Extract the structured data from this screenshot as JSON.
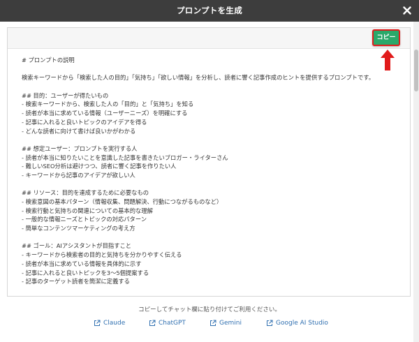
{
  "header": {
    "title": "プロンプトを生成"
  },
  "toolbar": {
    "copy_label": "コピー"
  },
  "prompt_lines": [
    "# プロンプトの説明",
    "",
    "検索キーワードから「検索した人の目的」「気持ち」「欲しい情報」を分析し、読者に響く記事作成のヒントを提供するプロンプトです。",
    "",
    "## 目的：ユーザーが得たいもの",
    "- 検索キーワードから、検索した人の「目的」と「気持ち」を知る",
    "- 読者が本当に求めている情報（ユーザーニーズ）を明確にする",
    "- 記事に入れると良いトピックのアイデアを得る",
    "- どんな読者に向けて書けば良いかがわかる",
    "",
    "## 想定ユーザー：プロンプトを実行する人",
    "- 読者が本当に知りたいことを意識した記事を書きたいブロガー・ライターさん",
    "- 難しいSEO分析は避けつつ、読者に響く記事を作りたい人",
    "- キーワードから記事のアイデアが欲しい人",
    "",
    "## リソース：目的を達成するために必要なもの",
    "- 検索意図の基本パターン（情報収集、問題解決、行動につながるものなど）",
    "- 検索行動と気持ちの関連についての基本的な理解",
    "- 一般的な情報ニーズとトピックの対応パターン",
    "- 簡単なコンテンツマーケティングの考え方",
    "",
    "## ゴール：AIアシスタントが目指すこと",
    "- キーワードから検索者の目的と気持ちを分かりやすく伝える",
    "- 読者が本当に求めている情報を具体的に示す",
    "- 記事に入れると良いトピックを3〜5個提案する",
    "- 記事のターゲット読者を簡潔に定義する"
  ],
  "footer": {
    "note": "コピーしてチャット欄に貼り付けてご利用ください。",
    "links": [
      {
        "label": "Claude"
      },
      {
        "label": "ChatGPT"
      },
      {
        "label": "Gemini"
      },
      {
        "label": "Google AI Studio"
      }
    ]
  },
  "colors": {
    "header_bg": "#3d3d3d",
    "copy_button": "#2ba86a",
    "highlight_red": "#e11b1b",
    "link": "#2f6fb0"
  },
  "icons": {
    "close": "close-icon",
    "arrow": "arrow-up-icon",
    "external_link": "external-link-icon"
  }
}
